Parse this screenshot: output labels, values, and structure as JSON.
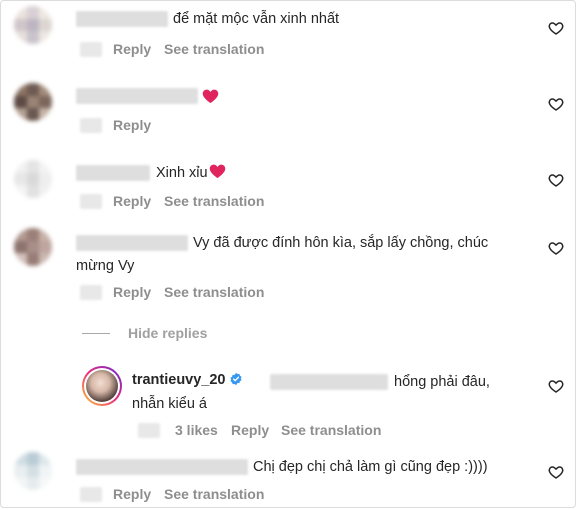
{
  "actions": {
    "reply": "Reply",
    "see_translation": "See translation",
    "hide_replies": "Hide replies"
  },
  "comments": [
    {
      "text": "để mặt mộc vẫn xinh nhất"
    },
    {
      "text": ""
    },
    {
      "text": "Xinh xỉu"
    },
    {
      "text_line1": "Vy đã được đính hôn kìa, sắp lấy chồng, chúc",
      "text_line2": "mừng Vy"
    },
    {
      "text": "Chị đẹp chị chả làm gì cũng đẹp :))))"
    }
  ],
  "reply": {
    "username": "trantieuvy_20",
    "text_line1": "hổng phải đâu,",
    "text_line2": "nhẫn kiểu á",
    "likes": "3 likes"
  },
  "icons": {
    "like": "heart-outline-icon",
    "emoji": "red-heart-emoji",
    "verified": "verified-badge-icon"
  },
  "colors": {
    "text": "#262626",
    "meta": "#8e8e8e",
    "verified": "#3897f0",
    "heart": "#e0245e"
  }
}
